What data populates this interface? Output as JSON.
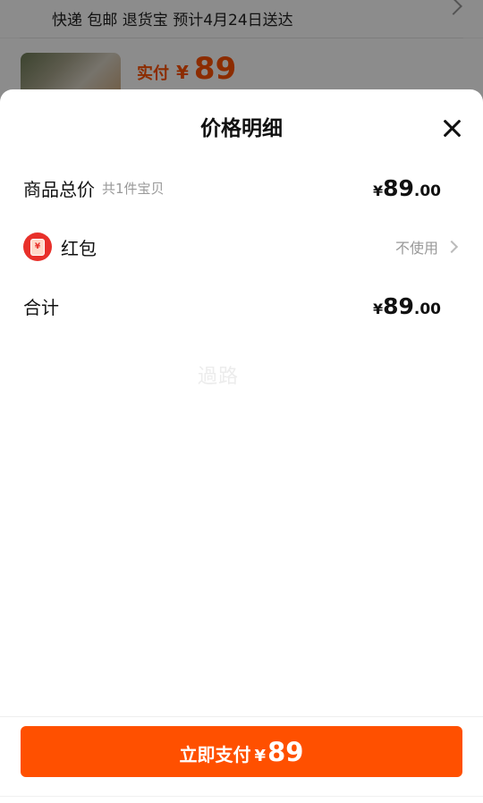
{
  "background": {
    "shipping_text": "快递 包邮 退货宝 预计4月24日送达",
    "paid_label": "实付",
    "paid_currency": "¥",
    "paid_amount": "89"
  },
  "sheet": {
    "title": "价格明细",
    "rows": {
      "subtotal": {
        "label": "商品总价",
        "sub": "共1件宝贝",
        "currency": "¥",
        "amount_int": "89",
        "amount_dec": ".00"
      },
      "redpack": {
        "label": "红包",
        "icon": "red-packet-icon",
        "icon_glyph": "¥",
        "action": "不使用"
      },
      "total": {
        "label": "合计",
        "currency": "¥",
        "amount_int": "89",
        "amount_dec": ".00"
      }
    },
    "watermark": "過路"
  },
  "footer": {
    "pay_label": "立即支付",
    "pay_currency": "¥",
    "pay_amount": "89"
  },
  "colors": {
    "accent": "#ff5000",
    "redpack": "#e8302a",
    "muted": "#999999"
  }
}
